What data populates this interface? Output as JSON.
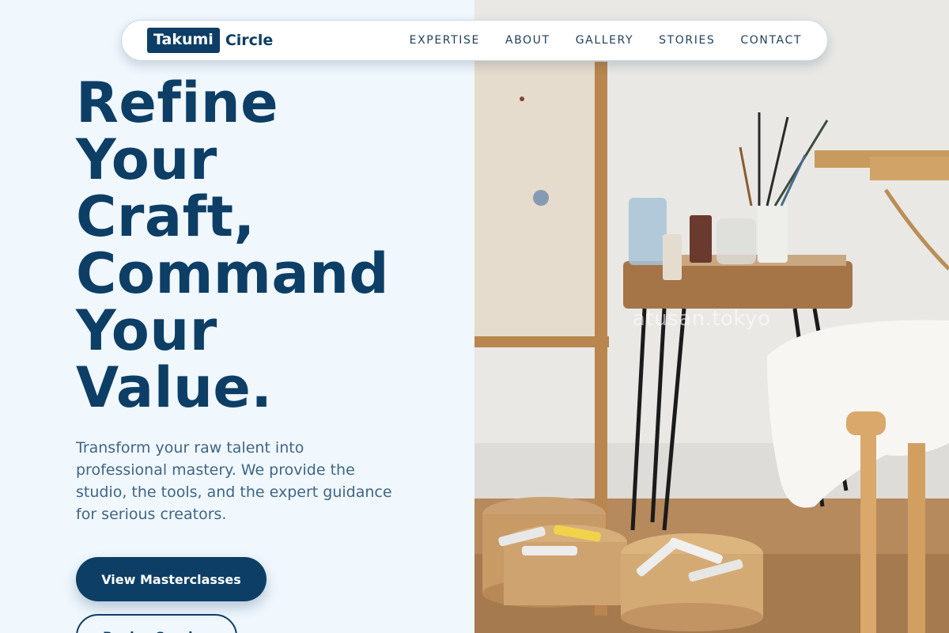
{
  "brand": {
    "logo_box": "Takumi",
    "logo_word": "Circle"
  },
  "nav": {
    "links": [
      "EXPERTISE",
      "ABOUT",
      "GALLERY",
      "STORIES",
      "CONTACT"
    ]
  },
  "hero": {
    "headline": [
      "Refine",
      "Your",
      "Craft,",
      "Command",
      "Your",
      "Value."
    ],
    "lede": "Transform your raw talent into professional mastery. We provide the studio, the tools, and the expert guidance for serious creators.",
    "primary_cta": "View Masterclasses",
    "secondary_cta": "Book a Session"
  },
  "photo": {
    "watermark": "atusan.tokyo"
  },
  "colors": {
    "page_bg": "#f0f7fd",
    "brand_navy": "#0d3e66",
    "lede_text": "#3f6685",
    "nav_text": "#1f3f5c"
  }
}
